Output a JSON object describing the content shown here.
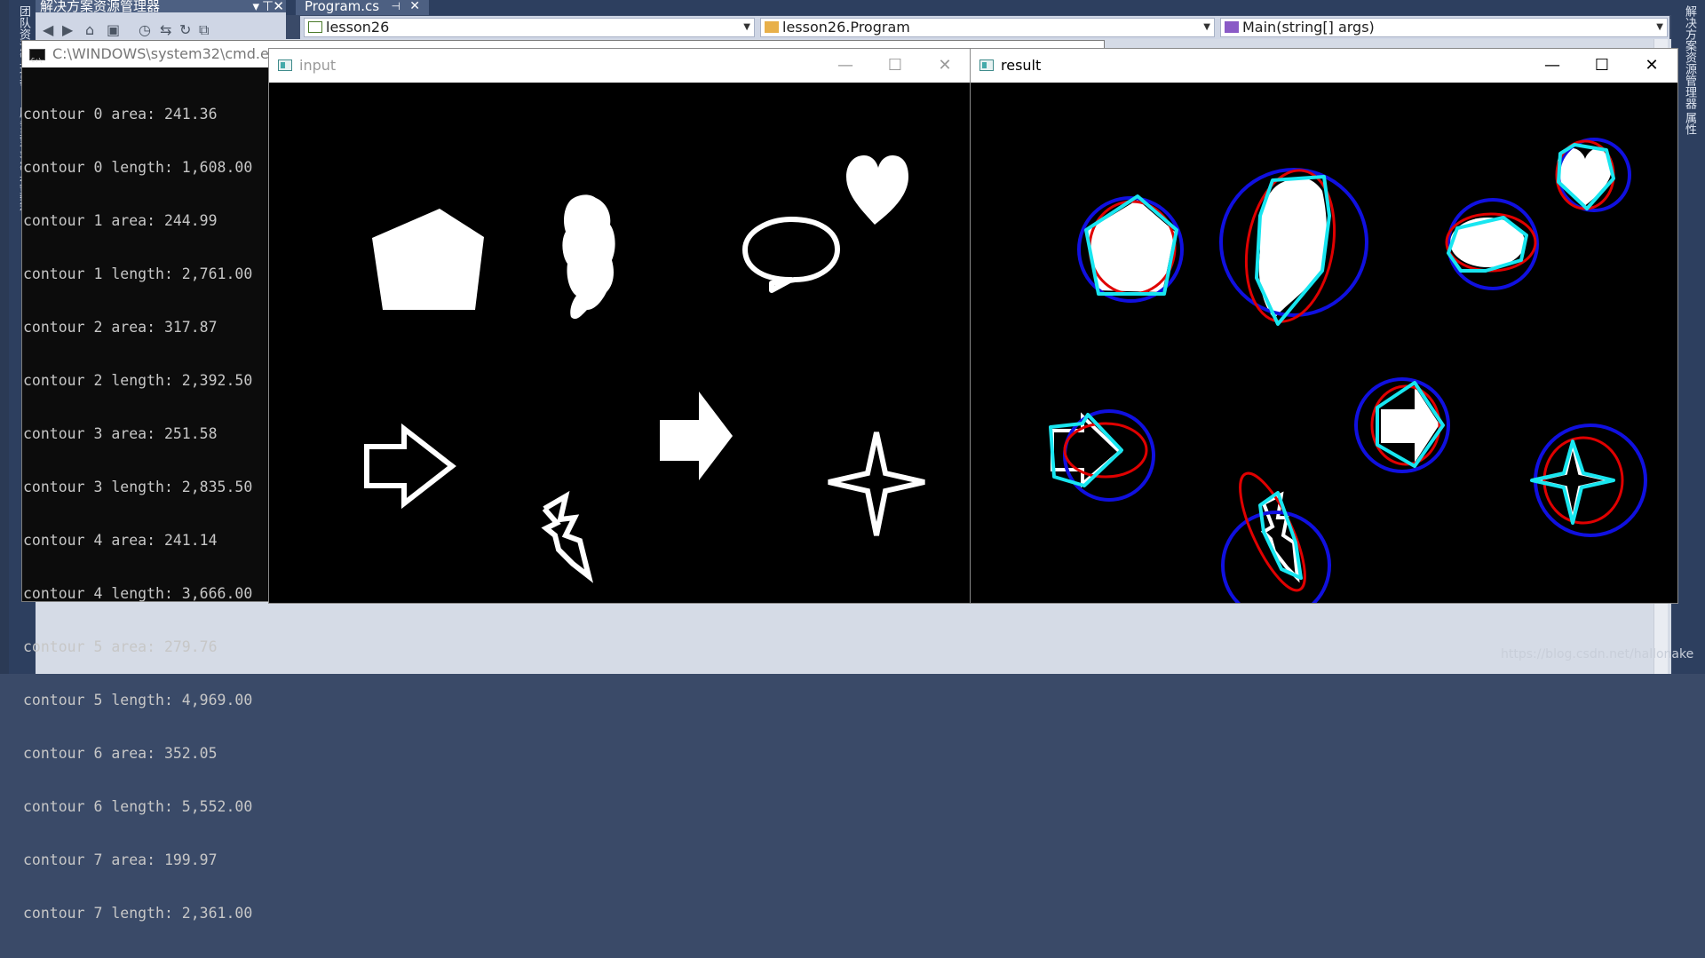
{
  "vs": {
    "solution_explorer_title": "解决方案资源管理器",
    "left_tabs": [
      "团队资源管理器",
      "服务器资源管理器",
      "工具箱"
    ],
    "right_tabs": [
      "解决方案资源管理器",
      "属性"
    ],
    "editor_tab": "Program.cs",
    "nav": {
      "project": "lesson26",
      "class": "lesson26.Program",
      "member": "Main(string[] args)"
    }
  },
  "cmd": {
    "title": "C:\\WINDOWS\\system32\\cmd.exe",
    "lines": [
      "contour 0 area: 241.36",
      "contour 0 length: 1,608.00",
      "contour 1 area: 244.99",
      "contour 1 length: 2,761.00",
      "contour 2 area: 317.87",
      "contour 2 length: 2,392.50",
      "contour 3 area: 251.58",
      "contour 3 length: 2,835.50",
      "contour 4 area: 241.14",
      "contour 4 length: 3,666.00",
      "contour 5 area: 279.76",
      "contour 5 length: 4,969.00",
      "contour 6 area: 352.05",
      "contour 6 length: 5,552.00",
      "contour 7 area: 199.97",
      "contour 7 length: 2,361.00"
    ]
  },
  "input_window": {
    "title": "input",
    "minimize": "—",
    "maximize": "☐",
    "close": "✕"
  },
  "result_window": {
    "title": "result",
    "minimize": "—",
    "maximize": "☐",
    "close": "✕"
  },
  "colors": {
    "circle": "#1010e0",
    "ellipse": "#e00000",
    "hull": "#18e6f0"
  },
  "watermark": "https://blog.csdn.net/hallonake"
}
